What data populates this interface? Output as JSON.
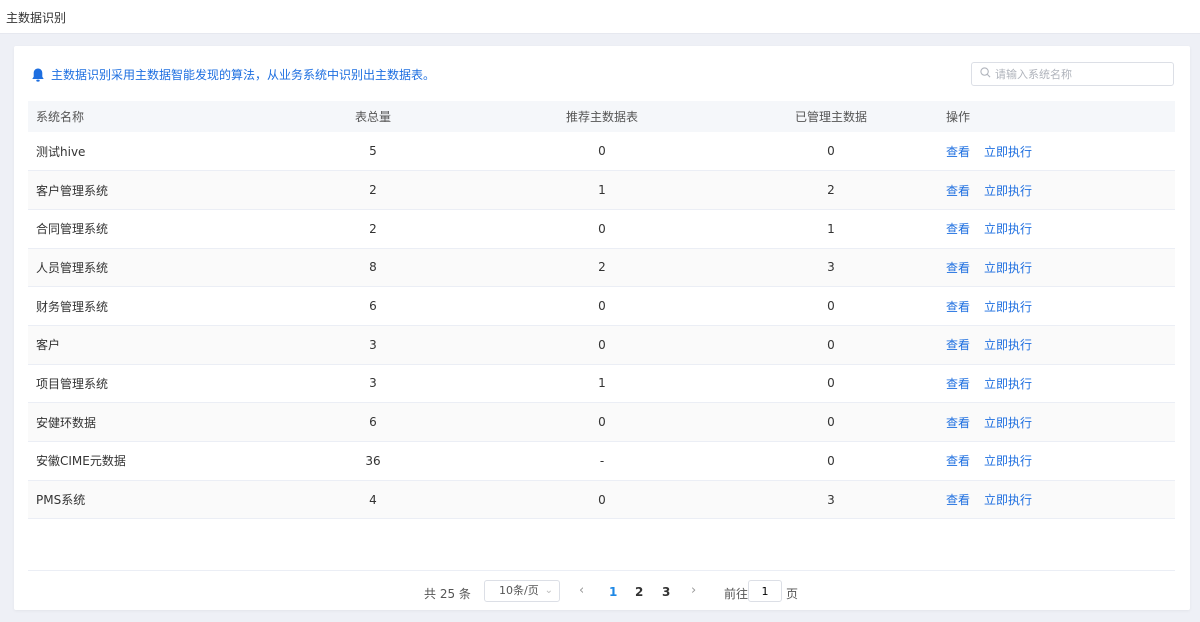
{
  "header": {
    "title": "主数据识别"
  },
  "notice": {
    "text": "主数据识别采用主数据智能发现的算法，从业务系统中识别出主数据表。"
  },
  "search": {
    "placeholder": "请输入系统名称"
  },
  "table": {
    "columns": [
      "系统名称",
      "表总量",
      "推荐主数据表",
      "已管理主数据",
      "操作"
    ],
    "rows": [
      {
        "name": "测试hive",
        "total": "5",
        "recommended": "0",
        "managed": "0"
      },
      {
        "name": "客户管理系统",
        "total": "2",
        "recommended": "1",
        "managed": "2"
      },
      {
        "name": "合同管理系统",
        "total": "2",
        "recommended": "0",
        "managed": "1"
      },
      {
        "name": "人员管理系统",
        "total": "8",
        "recommended": "2",
        "managed": "3"
      },
      {
        "name": "财务管理系统",
        "total": "6",
        "recommended": "0",
        "managed": "0"
      },
      {
        "name": "客户",
        "total": "3",
        "recommended": "0",
        "managed": "0"
      },
      {
        "name": "项目管理系统",
        "total": "3",
        "recommended": "1",
        "managed": "0"
      },
      {
        "name": "安健环数据",
        "total": "6",
        "recommended": "0",
        "managed": "0"
      },
      {
        "name": "安徽CIME元数据",
        "total": "36",
        "recommended": "-",
        "managed": "0"
      },
      {
        "name": "PMS系统",
        "total": "4",
        "recommended": "0",
        "managed": "3"
      }
    ],
    "actions": {
      "view": "查看",
      "execute": "立即执行"
    }
  },
  "pagination": {
    "total_text": "共 25 条",
    "page_size": "10条/页",
    "pages": [
      "1",
      "2",
      "3"
    ],
    "current_page": "1",
    "goto_label": "前往",
    "goto_value": "1",
    "goto_suffix": "页"
  },
  "colors": {
    "accent": "#1e6fe0",
    "header_bg": "#f5f7fa",
    "page_bg": "#eef0f6"
  },
  "icons": {
    "notice": "bell-icon",
    "search": "search-icon"
  }
}
